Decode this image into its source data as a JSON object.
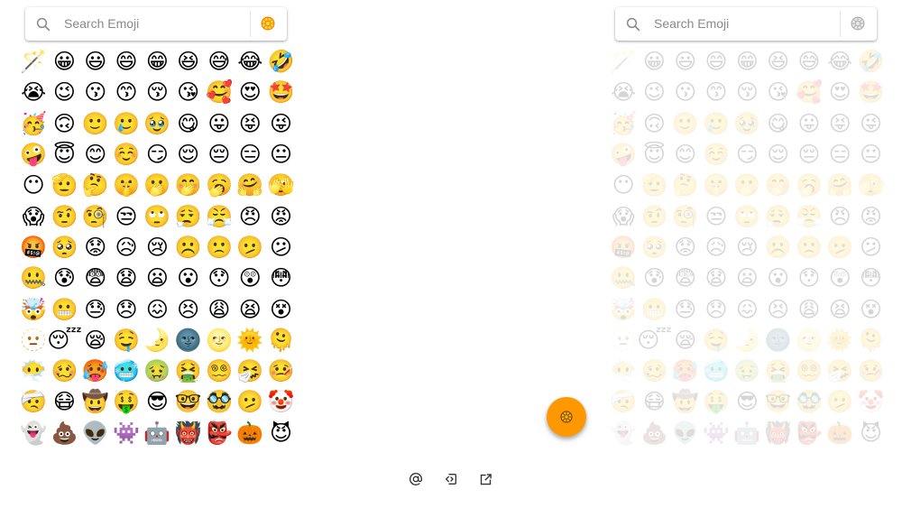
{
  "search": {
    "placeholder": "Search Emoji"
  },
  "colors": {
    "accent": "#ff9800",
    "icon_gray": "#8a8a8a",
    "footer_icon": "#333333"
  },
  "emojis": [
    "🪄",
    "😀",
    "😃",
    "😄",
    "😁",
    "😆",
    "😅",
    "😂",
    "🤣",
    "😭",
    "😉",
    "😗",
    "😙",
    "😚",
    "😘",
    "🥰",
    "😍",
    "🤩",
    "🥳",
    "🙃",
    "🙂",
    "🥲",
    "🥹",
    "😋",
    "😛",
    "😝",
    "😜",
    "🤪",
    "😇",
    "😊",
    "☺️",
    "😏",
    "😌",
    "😔",
    "😑",
    "😐",
    "😶",
    "🫡",
    "🤔",
    "🤫",
    "🫢",
    "🤭",
    "🥱",
    "🤗",
    "🫣",
    "😱",
    "🤨",
    "🧐",
    "😒",
    "🙄",
    "😮‍💨",
    "😤",
    "😠",
    "😡",
    "🤬",
    "🥺",
    "😟",
    "😥",
    "😢",
    "☹️",
    "🙁",
    "🫤",
    "😕",
    "🤐",
    "😰",
    "😨",
    "😧",
    "😦",
    "😮",
    "😯",
    "😲",
    "😳",
    "🤯",
    "😬",
    "😓",
    "😞",
    "😖",
    "😣",
    "😩",
    "😫",
    "😵",
    "🫥",
    "😴",
    "😪",
    "🤤",
    "🌛",
    "🌚",
    "🌝",
    "🌞",
    "🫠",
    "😶‍🌫️",
    "🥴",
    "🥵",
    "🥶",
    "🤢",
    "🤮",
    "😵‍💫",
    "🤧",
    "🤒",
    "🤕",
    "😷",
    "🤠",
    "🤑",
    "😎",
    "🤓",
    "🥸",
    "🫤",
    "🤡",
    "👻",
    "💩",
    "👽",
    "👾",
    "🤖",
    "👹",
    "👺",
    "🎃",
    "😈"
  ],
  "icons": {
    "search": "search-icon",
    "mode": "emoji-kitchen-icon",
    "fab": "emoji-kitchen-icon",
    "footer": [
      "at-sign-icon",
      "code-icon",
      "external-link-icon"
    ]
  }
}
